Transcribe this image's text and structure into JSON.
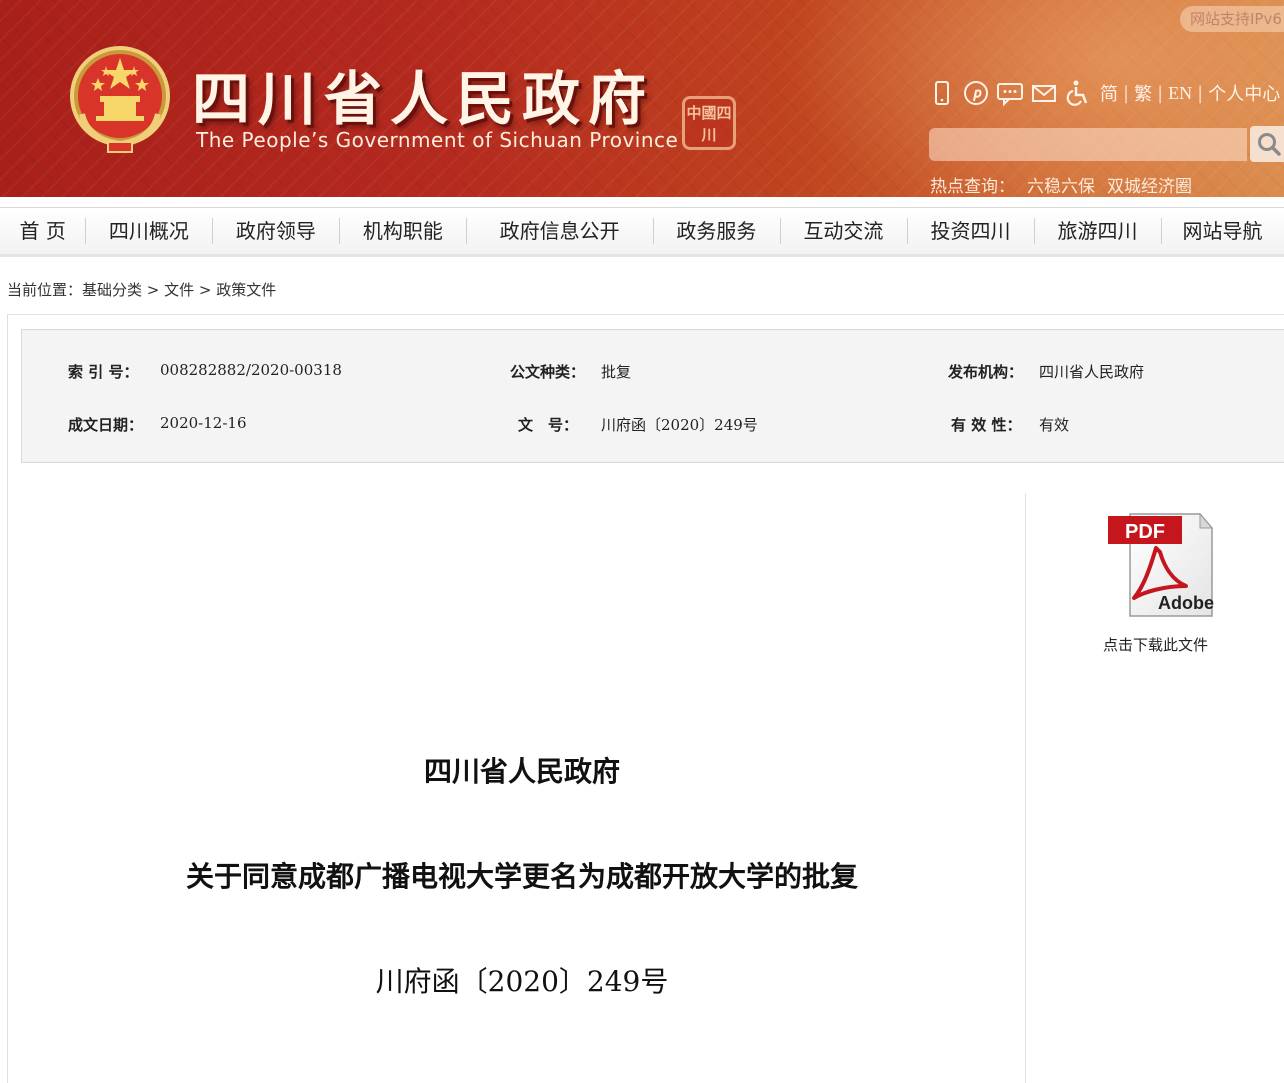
{
  "header": {
    "title": "四川省人民政府",
    "subtitle": "The People’s Government of Sichuan Province",
    "seal_text": "中國四川",
    "ipv6_badge": "网站支持IPv6",
    "tools": {
      "icons": [
        "mobile-icon",
        "pinterest-icon",
        "message-icon",
        "mail-icon",
        "accessibility-icon"
      ],
      "lang_simplified": "简",
      "lang_traditional": "繁",
      "lang_english": "EN",
      "personal_center": "个人中心",
      "separator": "|"
    },
    "search": {
      "placeholder": "",
      "button_icon": "search-icon"
    },
    "hot": {
      "label": "热点查询：",
      "items": [
        "六稳六保",
        "双城经济圈"
      ]
    }
  },
  "nav": {
    "items": [
      "首 页",
      "四川概况",
      "政府领导",
      "机构职能",
      "政府信息公开",
      "政务服务",
      "互动交流",
      "投资四川",
      "旅游四川",
      "网站导航"
    ]
  },
  "breadcrumb": {
    "prefix": "当前位置：",
    "path": [
      "基础分类",
      "文件",
      "政策文件"
    ],
    "separator": " > "
  },
  "meta": {
    "index_label": "索 引 号：",
    "index_value": "008282882/2020-00318",
    "type_label": "公文种类：",
    "type_value": "批复",
    "org_label": "发布机构：",
    "org_value": "四川省人民政府",
    "date_label": "成文日期：",
    "date_value": "2020-12-16",
    "number_label": "文　号：",
    "number_value": "川府函〔2020〕249号",
    "validity_label": "有 效 性：",
    "validity_value": "有效"
  },
  "download": {
    "icon": "pdf-icon",
    "pdf_text": "PDF",
    "brand_text": "Adobe",
    "caption": "点击下载此文件"
  },
  "document": {
    "issuer": "四川省人民政府",
    "title": "关于同意成都广播电视大学更名为成都开放大学的批复",
    "number": "川府函〔2020〕249号"
  },
  "colors": {
    "header_red": "#b52a1f",
    "header_orange": "#d98a4c",
    "nav_bg": "#f2f2f2"
  }
}
